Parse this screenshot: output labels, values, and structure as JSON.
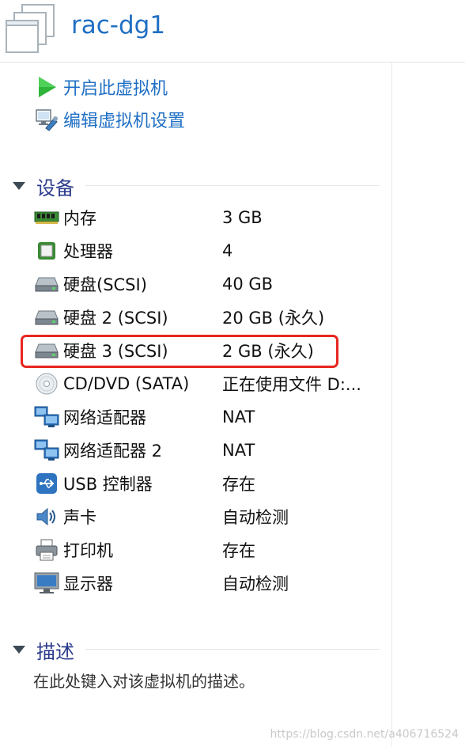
{
  "vm": {
    "title": "rac-dg1"
  },
  "actions": [
    {
      "label": "开启此虚拟机",
      "icon": "play-icon"
    },
    {
      "label": "编辑虚拟机设置",
      "icon": "edit-settings-icon"
    }
  ],
  "devices_section": {
    "title": "设备"
  },
  "devices": [
    {
      "name": "内存",
      "value": "3 GB",
      "icon": "memory-icon"
    },
    {
      "name": "处理器",
      "value": "4",
      "icon": "processor-icon"
    },
    {
      "name": "硬盘(SCSI)",
      "value": "40 GB",
      "icon": "hard-disk-icon"
    },
    {
      "name": "硬盘 2 (SCSI)",
      "value": "20 GB (永久)",
      "icon": "hard-disk-icon"
    },
    {
      "name": "硬盘 3 (SCSI)",
      "value": "2 GB (永久)",
      "icon": "hard-disk-icon"
    },
    {
      "name": "CD/DVD (SATA)",
      "value": "正在使用文件 D:...",
      "icon": "cd-dvd-icon"
    },
    {
      "name": "网络适配器",
      "value": "NAT",
      "icon": "network-adapter-icon"
    },
    {
      "name": "网络适配器 2",
      "value": "NAT",
      "icon": "network-adapter-icon"
    },
    {
      "name": "USB 控制器",
      "value": "存在",
      "icon": "usb-icon"
    },
    {
      "name": "声卡",
      "value": "自动检测",
      "icon": "speaker-icon"
    },
    {
      "name": "打印机",
      "value": "存在",
      "icon": "printer-icon"
    },
    {
      "name": "显示器",
      "value": "自动检测",
      "icon": "monitor-icon"
    }
  ],
  "description_section": {
    "title": "描述",
    "placeholder": "在此处键入对该虚拟机的描述。"
  },
  "watermark": "https://blog.csdn.net/a406716524",
  "colors": {
    "link": "#1f6fc4",
    "section": "#2b3b8c",
    "highlight": "#e8261f"
  }
}
